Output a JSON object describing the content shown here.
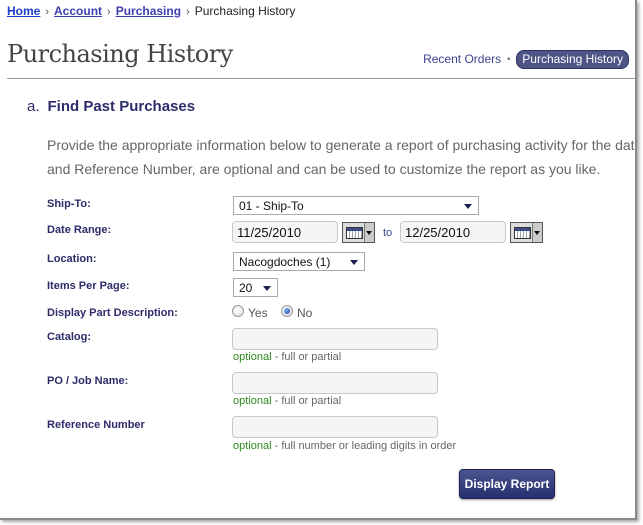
{
  "breadcrumb": {
    "items": [
      "Home",
      "Account",
      "Purchasing"
    ],
    "current": "Purchasing History",
    "separator": "›"
  },
  "page_title": "Purchasing History",
  "subnav": {
    "link": "Recent Orders",
    "separator": "•",
    "active": "Purchasing History"
  },
  "section": {
    "letter": "a.",
    "title": "Find Past Purchases",
    "intro_line1": "Provide the appropriate information below to generate a report of purchasing activity for the date range",
    "intro_line2": "and Reference Number, are optional and can be used to customize the report as you like."
  },
  "form": {
    "ship_to": {
      "label": "Ship-To:",
      "value": "01 -  Ship-To"
    },
    "date_range": {
      "label": "Date Range:",
      "from": "11/25/2010",
      "to_label": "to",
      "to": "12/25/2010"
    },
    "location": {
      "label": "Location:",
      "value": "Nacogdoches (1)"
    },
    "items_per_page": {
      "label": "Items Per Page:",
      "value": "20"
    },
    "display_part": {
      "label": "Display Part Description:",
      "yes": "Yes",
      "no": "No",
      "selected": "No"
    },
    "catalog": {
      "label": "Catalog:",
      "value": "",
      "hint_optional": "optional",
      "hint": " - full or partial"
    },
    "po_job": {
      "label": "PO / Job Name:",
      "value": "",
      "hint_optional": "optional",
      "hint": " - full or partial"
    },
    "reference": {
      "label": "Reference Number",
      "value": "",
      "hint_optional": "optional",
      "hint": " - full number or leading digits in order"
    }
  },
  "submit_label": "Display Report"
}
